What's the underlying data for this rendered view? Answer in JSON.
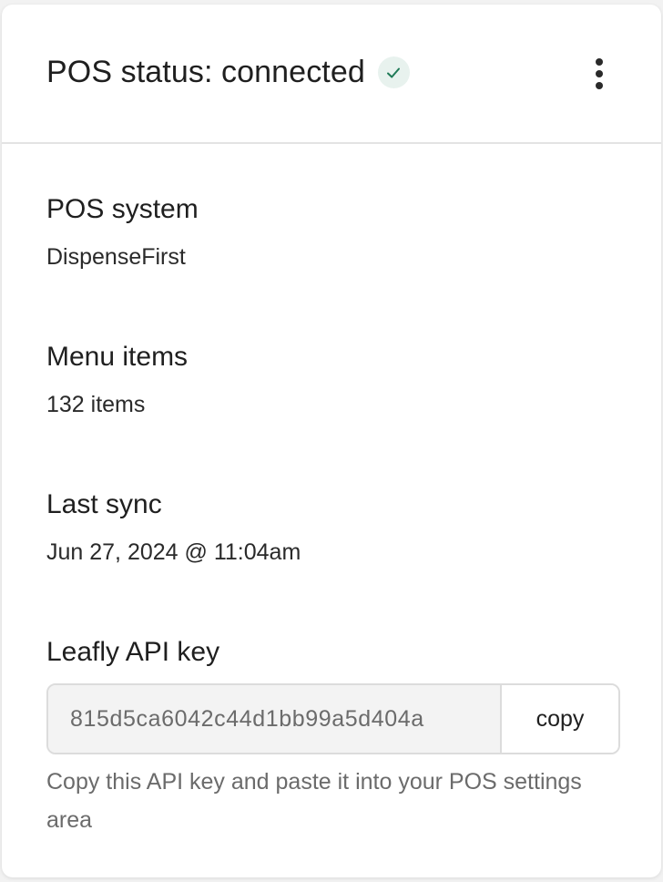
{
  "header": {
    "title": "POS status: connected",
    "status_icon": "check-icon",
    "menu_icon": "more-vertical-icon"
  },
  "sections": {
    "pos_system": {
      "label": "POS system",
      "value": "DispenseFirst"
    },
    "menu_items": {
      "label": "Menu items",
      "value": "132 items"
    },
    "last_sync": {
      "label": "Last sync",
      "value": "Jun 27, 2024 @ 11:04am"
    },
    "api_key": {
      "label": "Leafly API key",
      "value": "815d5ca6042c44d1bb99a5d404a",
      "copy_label": "copy",
      "helper": "Copy this API key and paste it into your POS settings area"
    }
  },
  "colors": {
    "success_badge_bg": "#e8f2ee",
    "success_check": "#1f7a57",
    "divider": "#e3e3e3",
    "muted_text": "#6b6b6b"
  }
}
